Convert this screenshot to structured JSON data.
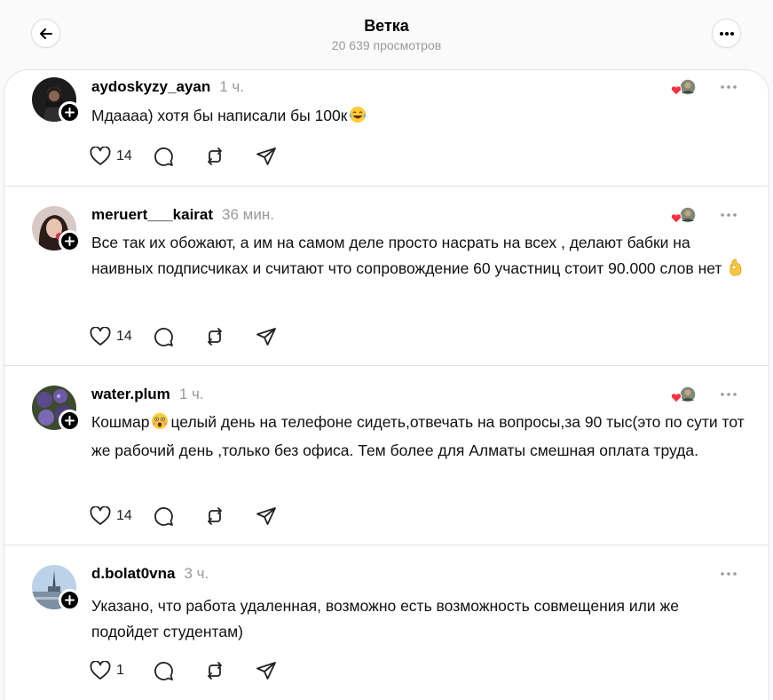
{
  "header": {
    "title": "Ветка",
    "views": "20 639 просмотров"
  },
  "posts": [
    {
      "username": "aydoskyzy_ayan",
      "time": "1 ч.",
      "text": "Мдаааа) хотя бы написали бы 100к",
      "emoji": "laughing-face",
      "likes": "14"
    },
    {
      "username": "meruert___kairat",
      "time": "36 мин.",
      "text": "Все так их обожают, а им на самом деле просто насрать на всех , делают бабки на наивных подписчиках и считают что сопровождение 60 участниц стоит 90.000 слов нет",
      "emoji": "ok-hand",
      "likes": "14"
    },
    {
      "username": "water.plum",
      "time": "1 ч.",
      "text_a": "Кошмар",
      "text_b": "целый день на телефоне сидеть,отвечать на вопросы,за 90 тыс(это по сути тот же рабочий день ,только без офиса. Тем более для Алматы смешная оплата труда.",
      "emoji": "astonished-face",
      "likes": "14"
    },
    {
      "username": "d.bolat0vna",
      "time": "3 ч.",
      "text": "Указано, что работа удаленная, возможно есть возможность совмещения или же подойдет студентам)",
      "likes": "1"
    }
  ],
  "colors": {
    "heart": "#ff3040",
    "muted": "#999999",
    "divider": "#e2e2e2"
  }
}
